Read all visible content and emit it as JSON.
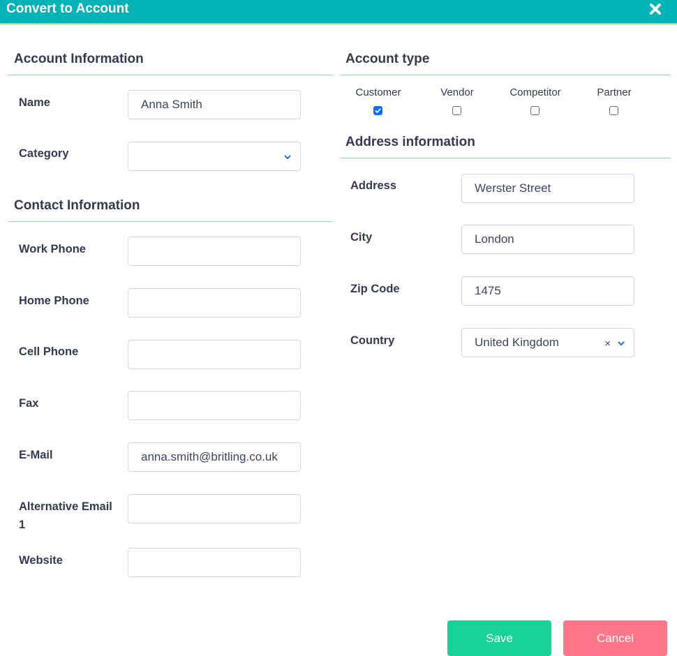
{
  "dialog": {
    "title": "Convert to Account",
    "close_icon": "close-icon"
  },
  "account_info": {
    "heading": "Account Information",
    "name": {
      "label": "Name",
      "value": "Anna Smith"
    },
    "category": {
      "label": "Category",
      "value": ""
    }
  },
  "contact_info": {
    "heading": "Contact Information",
    "fields": [
      {
        "label": "Work Phone",
        "value": ""
      },
      {
        "label": "Home Phone",
        "value": ""
      },
      {
        "label": "Cell Phone",
        "value": ""
      },
      {
        "label": "Fax",
        "value": ""
      },
      {
        "label": "E-Mail",
        "value": "anna.smith@britling.co.uk"
      },
      {
        "label": "Alternative Email 1",
        "value": ""
      },
      {
        "label": "Website",
        "value": ""
      }
    ]
  },
  "account_type": {
    "heading": "Account type",
    "options": [
      {
        "label": "Customer",
        "checked": true
      },
      {
        "label": "Vendor",
        "checked": false
      },
      {
        "label": "Competitor",
        "checked": false
      },
      {
        "label": "Partner",
        "checked": false
      }
    ]
  },
  "address_info": {
    "heading": "Address information",
    "address": {
      "label": "Address",
      "value": "Werster Street"
    },
    "city": {
      "label": "City",
      "value": "London"
    },
    "zip": {
      "label": "Zip Code",
      "value": "1475"
    },
    "country": {
      "label": "Country",
      "value": "United Kingdom",
      "clear_symbol": "×"
    }
  },
  "footer": {
    "save_label": "Save",
    "cancel_label": "Cancel"
  },
  "colors": {
    "header": "#00b3b6",
    "divider": "#8ee6a6",
    "save": "#18d398",
    "cancel": "#ff7689",
    "checkbox_checked": "#0d6efd"
  }
}
